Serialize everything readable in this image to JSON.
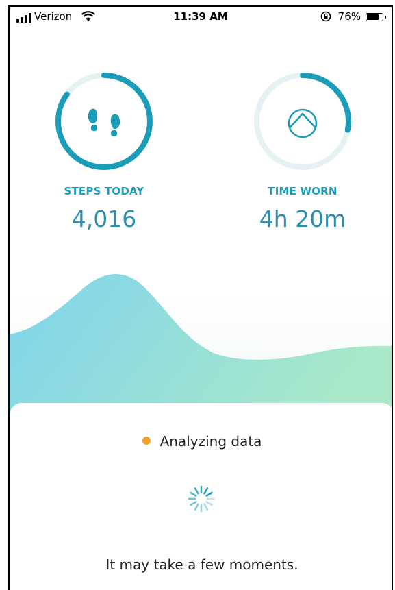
{
  "status_bar": {
    "carrier": "Verizon",
    "time": "11:39 AM",
    "battery_percent": "76%",
    "battery_level": 0.76
  },
  "stats": {
    "steps": {
      "label": "STEPS TODAY",
      "value": "4,016",
      "ring_progress": 0.85,
      "icon": "footprints-icon"
    },
    "worn": {
      "label": "TIME WORN",
      "value": "4h 20m",
      "ring_progress": 0.28,
      "icon": "ring-device-icon"
    }
  },
  "status": {
    "analyzing_label": "Analyzing data",
    "dot_color": "#f2a22a",
    "note": "It may take a few moments."
  },
  "colors": {
    "accent": "#1b9cb8",
    "ring_track": "#e6f1f4",
    "wave_start": "#7fd4ec",
    "wave_end": "#a8e8c9"
  }
}
